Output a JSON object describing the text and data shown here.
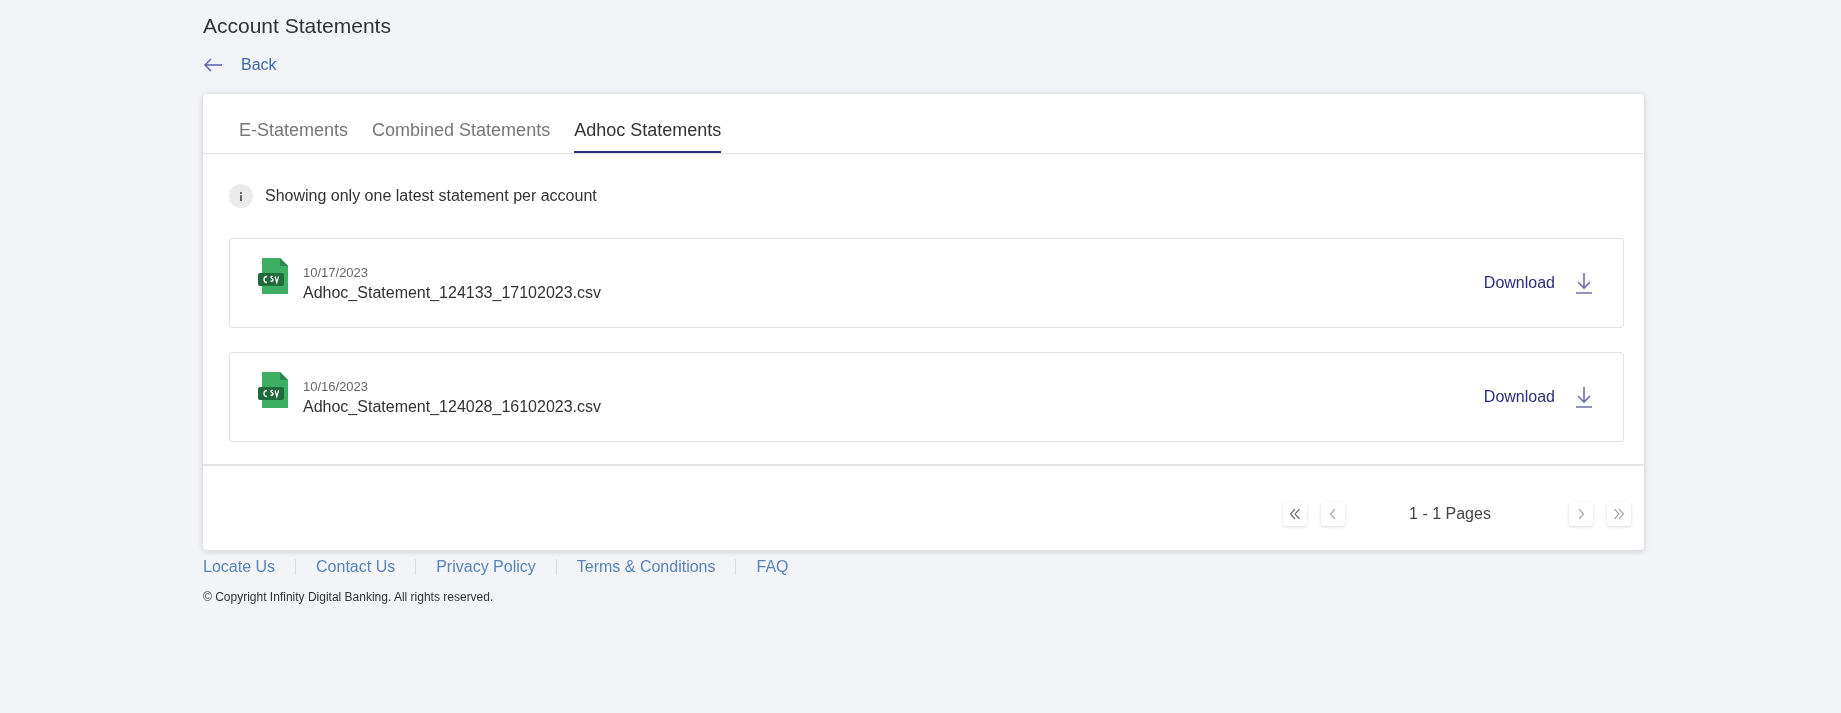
{
  "page": {
    "title": "Account Statements",
    "back": "Back"
  },
  "tabs": [
    {
      "label": "E-Statements",
      "selected": false
    },
    {
      "label": "Combined Statements",
      "selected": false
    },
    {
      "label": "Adhoc Statements",
      "selected": true
    }
  ],
  "notice": "Showing only one latest statement per account",
  "statements": [
    {
      "date": "10/17/2023",
      "file": "Adhoc_Statement_124133_17102023.csv",
      "action": "Download"
    },
    {
      "date": "10/16/2023",
      "file": "Adhoc_Statement_124028_16102023.csv",
      "action": "Download"
    }
  ],
  "pagination": {
    "label": "1 - 1 Pages"
  },
  "footer": {
    "links": [
      "Locate Us",
      "Contact Us",
      "Privacy Policy",
      "Terms & Conditions",
      "FAQ"
    ],
    "copyright": "© Copyright Infinity Digital Banking. All rights reserved."
  }
}
